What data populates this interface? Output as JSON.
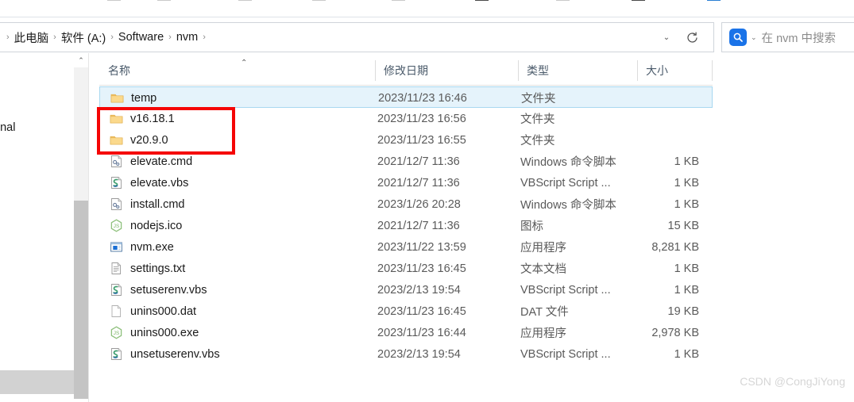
{
  "window": {
    "toolbar_icons": [
      "cut-icon",
      "copy-icon",
      "paste-icon",
      "rename-icon",
      "share-icon",
      "delete-icon",
      "new-folder-icon",
      "sort-icon",
      "view-icon",
      "filter-icon"
    ]
  },
  "address_bar": {
    "breadcrumb": [
      "此电脑",
      "软件 (A:)",
      "Software",
      "nvm"
    ],
    "separator": "›",
    "history_chevron": "⌄",
    "refresh_title": "刷新"
  },
  "search": {
    "icon": "search-icon",
    "chevron": "⌄",
    "placeholder": "在 nvm 中搜索"
  },
  "nav_pane": {
    "partial_label": "onal",
    "scrollbar_up": "⌃"
  },
  "file_list": {
    "columns": [
      {
        "key": "name",
        "label": "名称",
        "sorted": "asc",
        "sort_glyph": "⌃"
      },
      {
        "key": "date",
        "label": "修改日期"
      },
      {
        "key": "type",
        "label": "类型"
      },
      {
        "key": "size",
        "label": "大小"
      }
    ],
    "rows": [
      {
        "name": "temp",
        "date": "2023/11/23 16:46",
        "type": "文件夹",
        "size": "",
        "icon": "folder-icon",
        "selected": true
      },
      {
        "name": "v16.18.1",
        "date": "2023/11/23 16:56",
        "type": "文件夹",
        "size": "",
        "icon": "folder-icon",
        "selected": false
      },
      {
        "name": "v20.9.0",
        "date": "2023/11/23 16:55",
        "type": "文件夹",
        "size": "",
        "icon": "folder-icon",
        "selected": false
      },
      {
        "name": "elevate.cmd",
        "date": "2021/12/7 11:36",
        "type": "Windows 命令脚本",
        "size": "1 KB",
        "icon": "cmd-script-icon",
        "selected": false
      },
      {
        "name": "elevate.vbs",
        "date": "2021/12/7 11:36",
        "type": "VBScript Script ...",
        "size": "1 KB",
        "icon": "vbs-script-icon",
        "selected": false
      },
      {
        "name": "install.cmd",
        "date": "2023/1/26 20:28",
        "type": "Windows 命令脚本",
        "size": "1 KB",
        "icon": "cmd-script-icon",
        "selected": false
      },
      {
        "name": "nodejs.ico",
        "date": "2021/12/7 11:36",
        "type": "图标",
        "size": "15 KB",
        "icon": "nodejs-icon",
        "selected": false
      },
      {
        "name": "nvm.exe",
        "date": "2023/11/22 13:59",
        "type": "应用程序",
        "size": "8,281 KB",
        "icon": "application-icon",
        "selected": false
      },
      {
        "name": "settings.txt",
        "date": "2023/11/23 16:45",
        "type": "文本文档",
        "size": "1 KB",
        "icon": "text-file-icon",
        "selected": false
      },
      {
        "name": "setuserenv.vbs",
        "date": "2023/2/13 19:54",
        "type": "VBScript Script ...",
        "size": "1 KB",
        "icon": "vbs-script-icon",
        "selected": false
      },
      {
        "name": "unins000.dat",
        "date": "2023/11/23 16:45",
        "type": "DAT 文件",
        "size": "19 KB",
        "icon": "blank-file-icon",
        "selected": false
      },
      {
        "name": "unins000.exe",
        "date": "2023/11/23 16:44",
        "type": "应用程序",
        "size": "2,978 KB",
        "icon": "nodejs-icon",
        "selected": false
      },
      {
        "name": "unsetuserenv.vbs",
        "date": "2023/2/13 19:54",
        "type": "VBScript Script ...",
        "size": "1 KB",
        "icon": "vbs-script-icon",
        "selected": false
      }
    ]
  },
  "annotation": {
    "type": "rectangle-highlight",
    "color": "#f50505",
    "targets": [
      "v16.18.1",
      "v20.9.0"
    ]
  },
  "watermark": {
    "text": "CSDN @CongJiYong"
  },
  "colors": {
    "accent": "#1a73e8",
    "selection_bg": "#e5f3fb",
    "selection_border": "#a8d8f0",
    "annotation": "#f50505",
    "folder": "#f5c76a",
    "header_text": "#4a5a6a"
  }
}
